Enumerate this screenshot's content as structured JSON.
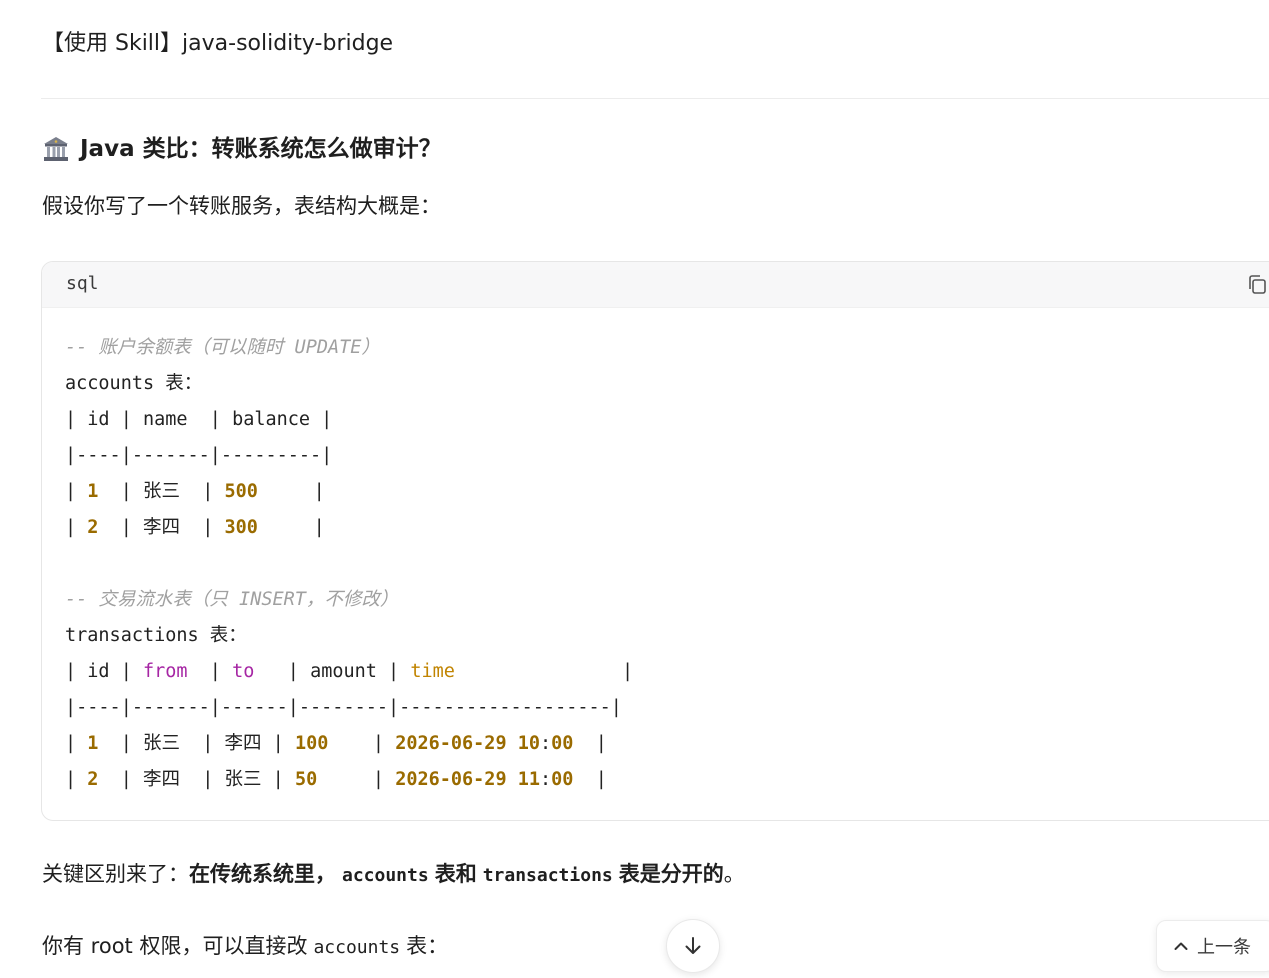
{
  "header": {
    "skill_line": "【使用 Skill】java-solidity-bridge"
  },
  "section": {
    "icon": "bank-icon",
    "title": "Java 类比：转账系统怎么做审计？",
    "intro": "假设你写了一个转账服务，表结构大概是："
  },
  "code_block": {
    "language": "sql",
    "copy_icon": "copy-icon",
    "lines": [
      [
        {
          "t": "-- 账户余额表（可以随时 UPDATE）",
          "c": "cmt"
        }
      ],
      [
        {
          "t": "accounts 表："
        }
      ],
      [
        {
          "t": "| id | name  | balance |"
        }
      ],
      [
        {
          "t": "|----|-------|---------|"
        }
      ],
      [
        {
          "t": "| "
        },
        {
          "t": "1",
          "c": "num"
        },
        {
          "t": "  | 张三  | "
        },
        {
          "t": "500",
          "c": "num"
        },
        {
          "t": "     |"
        }
      ],
      [
        {
          "t": "| "
        },
        {
          "t": "2",
          "c": "num"
        },
        {
          "t": "  | 李四  | "
        },
        {
          "t": "300",
          "c": "num"
        },
        {
          "t": "     |"
        }
      ],
      [
        {
          "t": ""
        }
      ],
      [
        {
          "t": "-- 交易流水表（只 INSERT，不修改）",
          "c": "cmt"
        }
      ],
      [
        {
          "t": "transactions 表："
        }
      ],
      [
        {
          "t": "| id | "
        },
        {
          "t": "from",
          "c": "kw"
        },
        {
          "t": "  | "
        },
        {
          "t": "to",
          "c": "kw"
        },
        {
          "t": "   | amount | "
        },
        {
          "t": "time",
          "c": "kwt"
        },
        {
          "t": "               |"
        }
      ],
      [
        {
          "t": "|----|-------|------|--------|-------------------|"
        }
      ],
      [
        {
          "t": "| "
        },
        {
          "t": "1",
          "c": "num"
        },
        {
          "t": "  | 张三  | 李四 | "
        },
        {
          "t": "100",
          "c": "num"
        },
        {
          "t": "    | "
        },
        {
          "t": "2026-06-29 10",
          "c": "num"
        },
        {
          "t": ":"
        },
        {
          "t": "00",
          "c": "num"
        },
        {
          "t": "  |"
        }
      ],
      [
        {
          "t": "| "
        },
        {
          "t": "2",
          "c": "num"
        },
        {
          "t": "  | 李四  | 张三 | "
        },
        {
          "t": "50",
          "c": "num"
        },
        {
          "t": "     | "
        },
        {
          "t": "2026-06-29 11",
          "c": "num"
        },
        {
          "t": ":"
        },
        {
          "t": "00",
          "c": "num"
        },
        {
          "t": "  |"
        }
      ]
    ]
  },
  "para1": {
    "prefix": "关键区别来了：",
    "bold_1": "在传统系统里，",
    "code_1": "accounts",
    "bold_2": "表和",
    "code_2": "transactions",
    "bold_3": "表是分开的",
    "suffix": "。"
  },
  "para2": {
    "prefix": "你有 root 权限，可以直接改",
    "code": "accounts",
    "suffix": "表："
  },
  "controls": {
    "scroll_down_icon": "arrow-down-icon",
    "prev_label": "上一条",
    "prev_icon": "chevron-up-icon"
  }
}
